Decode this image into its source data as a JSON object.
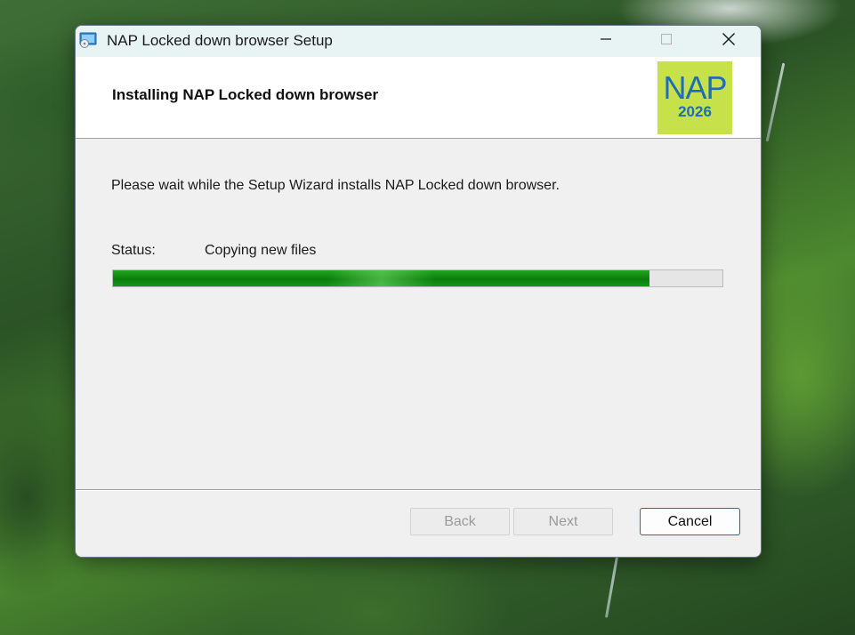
{
  "window": {
    "title": "NAP Locked down browser Setup"
  },
  "header": {
    "title": "Installing NAP Locked down browser",
    "logo": {
      "text": "NAP",
      "year": "2026",
      "background": "#c6e14a",
      "color": "#1e6db8"
    }
  },
  "main": {
    "message": "Please wait while the Setup Wizard installs NAP Locked down browser.",
    "status_label": "Status:",
    "status_value": "Copying new files",
    "progress_fraction": 0.88,
    "progress_color": "#0b7d0b"
  },
  "footer": {
    "back_label": "Back",
    "next_label": "Next",
    "cancel_label": "Cancel"
  },
  "icons": {
    "app": "installer-disk-icon",
    "minimize": "minimize-icon",
    "maximize": "maximize-icon",
    "close": "close-icon"
  }
}
